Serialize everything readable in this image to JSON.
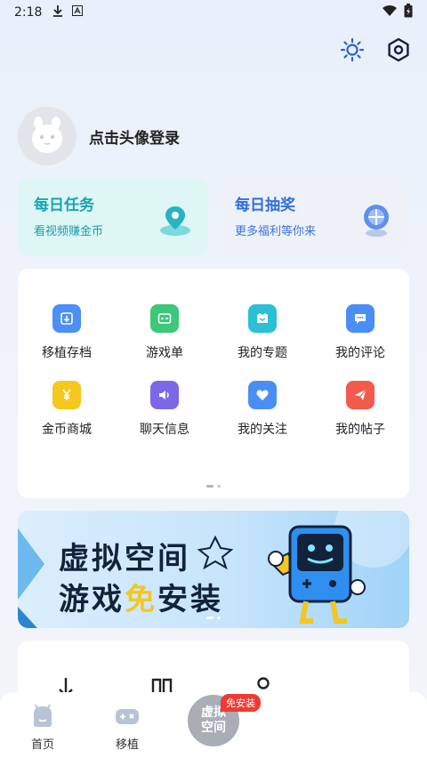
{
  "status_bar": {
    "time": "2:18",
    "icons": [
      "download-icon",
      "a-notification-icon",
      "wifi-icon",
      "battery-icon"
    ]
  },
  "header": {
    "icons": [
      "brightness-icon",
      "settings-icon"
    ]
  },
  "profile": {
    "login_text": "点击头像登录",
    "avatar_icon": "avatar-icon"
  },
  "promo_cards": [
    {
      "title": "每日任务",
      "subtitle": "看视频赚金币",
      "icon": "map-pin-icon",
      "accent": "#15a6b0"
    },
    {
      "title": "每日抽奖",
      "subtitle": "更多福利等你来",
      "icon": "compass-icon",
      "accent": "#2f6fe0"
    }
  ],
  "grid": {
    "items": [
      {
        "label": "移植存档",
        "icon": "archive-icon",
        "color": "#4b8ff7"
      },
      {
        "label": "游戏单",
        "icon": "gamelist-icon",
        "color": "#3cc77a"
      },
      {
        "label": "我的专题",
        "icon": "topic-icon",
        "color": "#2bc0d6"
      },
      {
        "label": "我的评论",
        "icon": "comment-icon",
        "color": "#4a8ef5"
      },
      {
        "label": "金币商城",
        "icon": "coin-icon",
        "color": "#f6c71c"
      },
      {
        "label": "聊天信息",
        "icon": "speaker-icon",
        "color": "#7a68e8"
      },
      {
        "label": "我的关注",
        "icon": "heart-icon",
        "color": "#4a8ef5"
      },
      {
        "label": "我的帖子",
        "icon": "send-icon",
        "color": "#f25a4c"
      }
    ]
  },
  "banner": {
    "line1": "虚拟空间",
    "line2_prefix": "游戏",
    "line2_accent": "免",
    "line2_suffix": "安装"
  },
  "tab_bar": {
    "tabs": [
      {
        "label": "首页",
        "icon": "home-icon"
      },
      {
        "label": "移植",
        "icon": "gamepad-icon"
      }
    ],
    "center": {
      "label": "虚拟\n空间",
      "badge": "免安装"
    }
  }
}
